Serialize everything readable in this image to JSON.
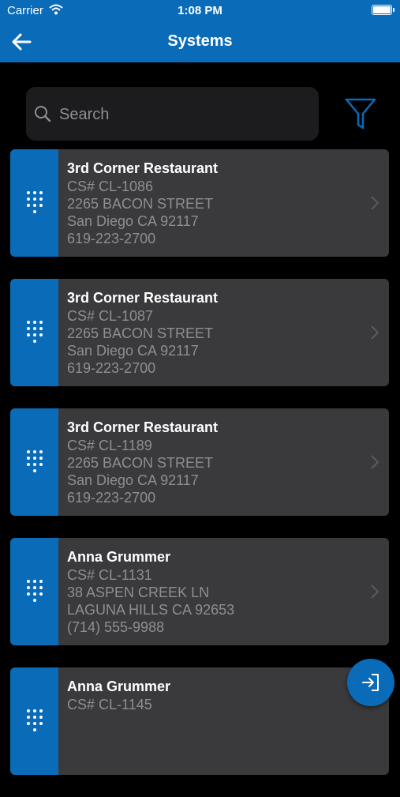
{
  "status_bar": {
    "carrier": "Carrier",
    "time": "1:08 PM"
  },
  "header": {
    "title": "Systems"
  },
  "search": {
    "placeholder": "Search"
  },
  "systems": [
    {
      "name": "3rd Corner Restaurant",
      "cs": "CS#  CL-1086",
      "street": "2265 BACON STREET",
      "city": "San Diego CA 92117",
      "phone": "619-223-2700"
    },
    {
      "name": "3rd Corner Restaurant",
      "cs": "CS#  CL-1087",
      "street": "2265 BACON STREET",
      "city": "San Diego CA 92117",
      "phone": "619-223-2700"
    },
    {
      "name": "3rd Corner Restaurant",
      "cs": "CS#  CL-1189",
      "street": "2265 BACON STREET",
      "city": "San Diego CA 92117",
      "phone": "619-223-2700"
    },
    {
      "name": "Anna Grummer",
      "cs": "CS#  CL-1131",
      "street": "38 ASPEN CREEK LN",
      "city": "LAGUNA HILLS CA 92653",
      "phone": "(714) 555-9988"
    },
    {
      "name": "Anna Grummer",
      "cs": "CS#  CL-1145",
      "street": "",
      "city": "",
      "phone": ""
    }
  ],
  "colors": {
    "accent": "#0a6bb8",
    "card": "#3a3a3c",
    "background": "#000000"
  }
}
